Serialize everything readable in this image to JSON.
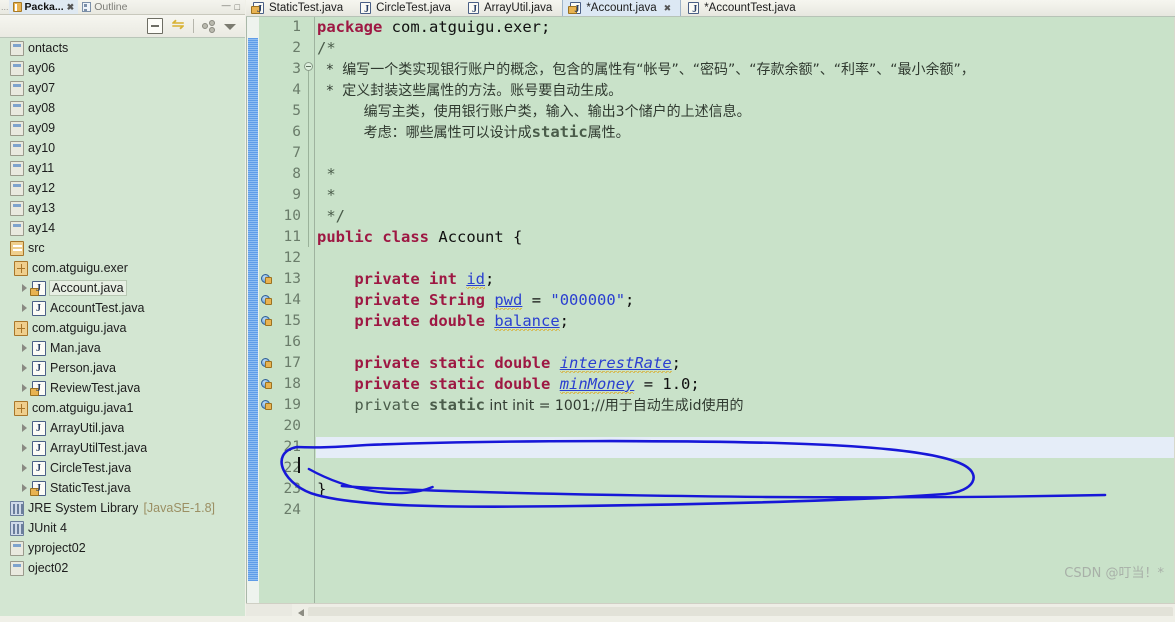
{
  "left_panel": {
    "tabs": [
      {
        "label": "Packa...",
        "icon": "package-icon",
        "active": true,
        "closable": true
      },
      {
        "label": "Outline",
        "icon": "outline-icon",
        "active": false,
        "closable": false
      }
    ],
    "toolbar": [
      {
        "name": "collapse-all-button",
        "title": "Collapse All"
      },
      {
        "name": "link-with-editor-button",
        "title": "Link with Editor"
      },
      {
        "name": "view-menu-button",
        "title": "View Menu"
      },
      {
        "name": "view-menu-caret",
        "title": "Menu"
      }
    ],
    "window_controls": [
      {
        "name": "minimize-button",
        "glyph": "—"
      },
      {
        "name": "maximize-button",
        "glyph": "□"
      }
    ],
    "tree": [
      {
        "label": "ontacts",
        "icon": "project-icon",
        "indent": 0,
        "arrow": false,
        "clipped": true
      },
      {
        "label": "ay06",
        "icon": "project-icon",
        "indent": 0,
        "arrow": false,
        "clipped": true
      },
      {
        "label": "ay07",
        "icon": "project-icon",
        "indent": 0,
        "arrow": false,
        "clipped": true
      },
      {
        "label": "ay08",
        "icon": "project-icon",
        "indent": 0,
        "arrow": false,
        "clipped": true
      },
      {
        "label": "ay09",
        "icon": "project-icon",
        "indent": 0,
        "arrow": false,
        "clipped": true
      },
      {
        "label": "ay10",
        "icon": "project-icon",
        "indent": 0,
        "arrow": false,
        "clipped": true
      },
      {
        "label": "ay11",
        "icon": "project-icon",
        "indent": 0,
        "arrow": false,
        "clipped": true
      },
      {
        "label": "ay12",
        "icon": "project-icon",
        "indent": 0,
        "arrow": false,
        "clipped": true
      },
      {
        "label": "ay13",
        "icon": "project-icon",
        "indent": 0,
        "arrow": false,
        "clipped": true
      },
      {
        "label": "ay14",
        "icon": "project-icon",
        "indent": 0,
        "arrow": false,
        "clipped": true
      },
      {
        "label": "src",
        "icon": "source-folder-icon",
        "indent": 0,
        "arrow": false,
        "clipped": true
      },
      {
        "label": "com.atguigu.exer",
        "icon": "package-icon",
        "indent": 1,
        "arrow": false
      },
      {
        "label": "Account.java",
        "icon": "java-file-locked-icon",
        "indent": 2,
        "arrow": true,
        "selected": true
      },
      {
        "label": "AccountTest.java",
        "icon": "java-file-icon",
        "indent": 2,
        "arrow": true
      },
      {
        "label": "com.atguigu.java",
        "icon": "package-icon",
        "indent": 1,
        "arrow": false
      },
      {
        "label": "Man.java",
        "icon": "java-file-icon",
        "indent": 2,
        "arrow": true
      },
      {
        "label": "Person.java",
        "icon": "java-file-icon",
        "indent": 2,
        "arrow": true
      },
      {
        "label": "ReviewTest.java",
        "icon": "java-file-locked-icon",
        "indent": 2,
        "arrow": true
      },
      {
        "label": "com.atguigu.java1",
        "icon": "package-icon",
        "indent": 1,
        "arrow": false
      },
      {
        "label": "ArrayUtil.java",
        "icon": "java-file-icon",
        "indent": 2,
        "arrow": true
      },
      {
        "label": "ArrayUtilTest.java",
        "icon": "java-file-icon",
        "indent": 2,
        "arrow": true
      },
      {
        "label": "CircleTest.java",
        "icon": "java-file-icon",
        "indent": 2,
        "arrow": true
      },
      {
        "label": "StaticTest.java",
        "icon": "java-file-locked-icon",
        "indent": 2,
        "arrow": true
      },
      {
        "label": "JRE System Library",
        "suffix": "[JavaSE-1.8]",
        "icon": "library-icon",
        "indent": 0,
        "arrow": false,
        "clipped": true
      },
      {
        "label": "JUnit 4",
        "icon": "library-icon",
        "indent": 0,
        "arrow": false,
        "clipped": true
      },
      {
        "label": "yproject02",
        "icon": "project-icon",
        "indent": 0,
        "arrow": false,
        "clipped": true
      },
      {
        "label": "oject02",
        "icon": "project-icon",
        "indent": 0,
        "arrow": false,
        "clipped": true
      }
    ]
  },
  "editor_tabs": [
    {
      "label": "StaticTest.java",
      "icon": "java-file-locked-icon",
      "active": false,
      "dirty": false
    },
    {
      "label": "CircleTest.java",
      "icon": "java-file-icon",
      "active": false,
      "dirty": false
    },
    {
      "label": "ArrayUtil.java",
      "icon": "java-file-icon",
      "active": false,
      "dirty": false
    },
    {
      "label": "*Account.java",
      "icon": "java-file-locked-icon",
      "active": true,
      "dirty": true,
      "closable": true
    },
    {
      "label": "*AccountTest.java",
      "icon": "java-file-icon",
      "active": false,
      "dirty": true
    }
  ],
  "editor": {
    "file": "Account.java",
    "current_line": 21,
    "line_numbers": [
      "1",
      "2",
      "3",
      "4",
      "5",
      "6",
      "7",
      "8",
      "9",
      "10",
      "11",
      "12",
      "13",
      "14",
      "15",
      "16",
      "17",
      "18",
      "19",
      "20",
      "21",
      "22",
      "23",
      "24"
    ],
    "code_lines": [
      "package com.atguigu.exer;",
      "/*",
      " *  编写一个类实现银行账户的概念，包含的属性有“帐号”、“密码”、“存款余额”、“利率”、“最小余额”，",
      " *  定义封装这些属性的方法。账号要自动生成。",
      "     编写主类，使用银行账户类，输入、输出3个储户的上述信息。",
      "     考虑：哪些属性可以设计成static属性。",
      "",
      " *",
      " *",
      " */",
      "public class Account {",
      "",
      "    private int id;",
      "    private String pwd = \"000000\";",
      "    private double balance;",
      "",
      "    private static double interestRate;",
      "    private static double minMoney = 1.0;",
      "    private static int init = 1001;//用于自动生成id使用的",
      "",
      "",
      "",
      "}",
      ""
    ],
    "field_marker_lines": [
      13,
      14,
      15,
      17,
      18,
      19
    ],
    "fold_marker_line": 2,
    "colors": {
      "background": "#c9e2c9",
      "keyword": "#9e1843",
      "string": "#2a3fd0",
      "field": "#2a3fd0",
      "comment": "#4a5c4a",
      "current_line": "#e5edf8",
      "change_bar": "#5f9ce8",
      "annotation_ink": "#1717d8"
    }
  },
  "watermark": "CSDN @叮当！*",
  "scrollbar": {
    "name": "horizontal-scrollbar",
    "left_arrow": "◀"
  }
}
